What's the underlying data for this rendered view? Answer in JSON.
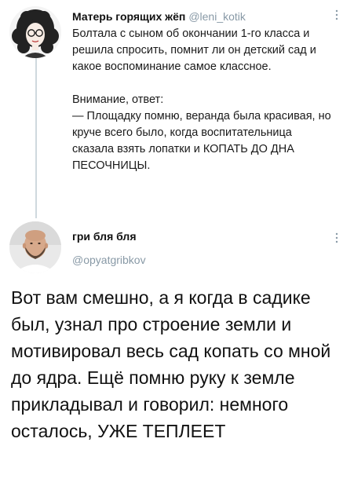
{
  "tweet1": {
    "author_name": "Матерь горящих жёп",
    "handle": "@leni_kotik",
    "text_p1": "Болтала с сыном об окончании 1-го класса и решила спросить, помнит ли он детский сад и какое воспоминание самое классное.",
    "text_p2": "Внимание, ответ:",
    "text_p3": "— Площадку помню, веранда была красивая, но круче всего было, когда воспитательница сказала взять лопатки и КОПАТЬ ДО ДНА ПЕСОЧНИЦЫ."
  },
  "tweet2": {
    "author_name": "гри бля бля",
    "handle": "@opyatgribkov",
    "text": "Вот вам смешно, а я когда в садике был, узнал про строение земли и мотивировал весь сад копать со мной до ядра. Ещё помню руку к земле прикладывал и говорил: немного осталось, УЖЕ ТЕПЛЕЕТ"
  },
  "colors": {
    "handle": "#8899a6",
    "thread_line": "#cfd9de"
  }
}
